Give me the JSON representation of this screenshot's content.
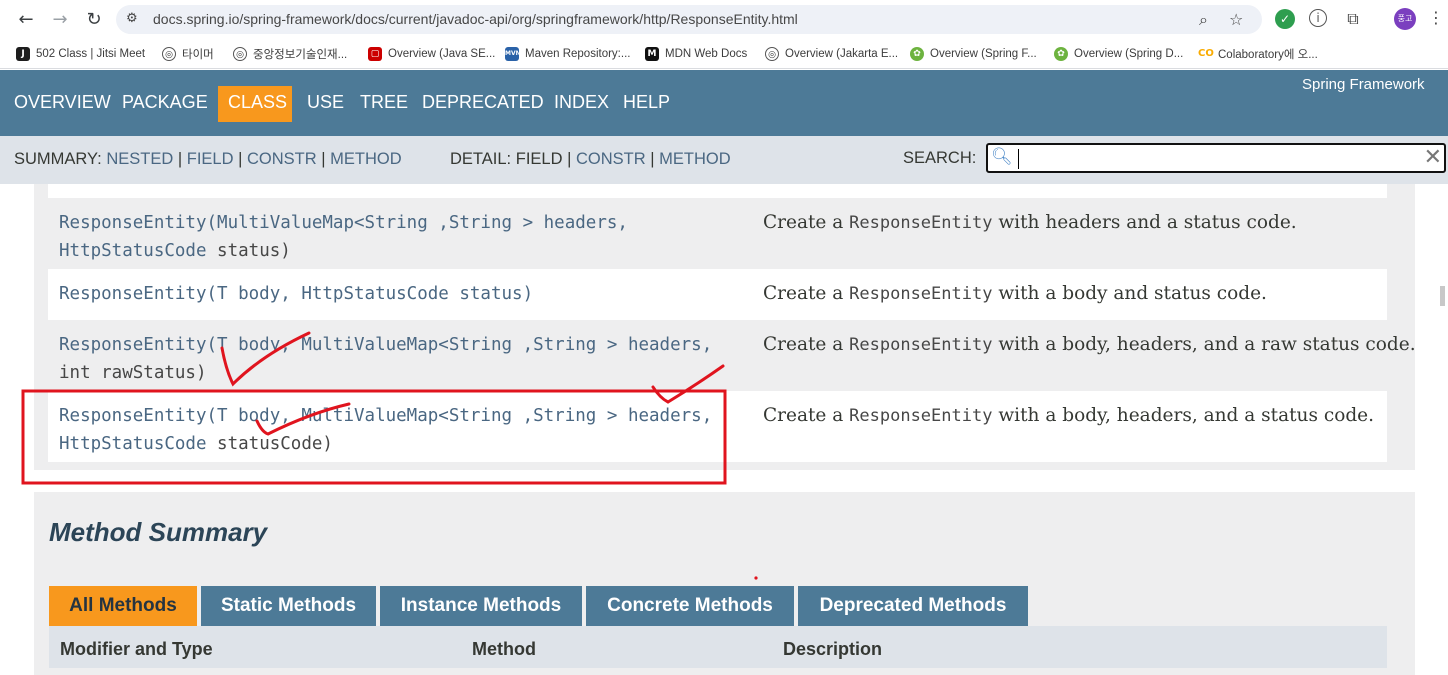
{
  "browser": {
    "url": "docs.spring.io/spring-framework/docs/current/javadoc-api/org/springframework/http/ResponseEntity.html",
    "avatar_label": "풍고",
    "bookmarks": [
      {
        "label": "502 Class | Jitsi Meet",
        "icon": "jitsi-icon"
      },
      {
        "label": "타이머",
        "icon": "globe-icon"
      },
      {
        "label": "중앙정보기술인재...",
        "icon": "globe-icon"
      },
      {
        "label": "Overview (Java SE...",
        "icon": "java-icon"
      },
      {
        "label": "Maven Repository:...",
        "icon": "maven-icon"
      },
      {
        "label": "MDN Web Docs",
        "icon": "mdn-icon"
      },
      {
        "label": "Overview (Jakarta E...",
        "icon": "globe-icon"
      },
      {
        "label": "Overview (Spring F...",
        "icon": "spring-icon"
      },
      {
        "label": "Overview (Spring D...",
        "icon": "spring-icon"
      },
      {
        "label": "Colaboratory에 오...",
        "icon": "colab-icon"
      }
    ]
  },
  "topnav": {
    "items": [
      "OVERVIEW",
      "PACKAGE",
      "CLASS",
      "USE",
      "TREE",
      "DEPRECATED",
      "INDEX",
      "HELP"
    ],
    "active": "CLASS",
    "brand": "Spring Framework"
  },
  "subnav": {
    "summary_label": "SUMMARY:",
    "summary_links": [
      "NESTED",
      "FIELD",
      "CONSTR",
      "METHOD"
    ],
    "detail_label": "DETAIL:",
    "detail_field": "FIELD",
    "detail_links": [
      "CONSTR",
      "METHOD"
    ],
    "separator": "|",
    "search_label": "SEARCH:"
  },
  "constructors": [
    {
      "line1_link": "ResponseEntity(MultiValueMap<String ,String > headers,",
      "line2_link": "HttpStatusCode",
      "line2_rest": " status)",
      "desc_pre": "Create a ",
      "desc_code": "ResponseEntity",
      "desc_post": " with headers and a status code."
    },
    {
      "line1_link": "ResponseEntity(T body, HttpStatusCode status)",
      "line2_link": "",
      "line2_rest": "",
      "desc_pre": "Create a ",
      "desc_code": "ResponseEntity",
      "desc_post": " with a body and status code."
    },
    {
      "line1_link": "ResponseEntity(T body, MultiValueMap<String ,String > headers,",
      "line2_link": "",
      "line2_rest": "int rawStatus)",
      "desc_pre": "Create a ",
      "desc_code": "ResponseEntity",
      "desc_post": " with a body, headers, and a raw status code."
    },
    {
      "line1_link": "ResponseEntity(T body, MultiValueMap<String ,String > headers,",
      "line2_link": "HttpStatusCode",
      "line2_rest": " statusCode)",
      "desc_pre": "Create a ",
      "desc_code": "ResponseEntity",
      "desc_post": " with a body, headers, and a status code."
    }
  ],
  "method_summary": {
    "title": "Method Summary",
    "tabs": [
      "All Methods",
      "Static Methods",
      "Instance Methods",
      "Concrete Methods",
      "Deprecated Methods"
    ],
    "active_tab": "All Methods",
    "columns": [
      "Modifier and Type",
      "Method",
      "Description"
    ]
  },
  "colors": {
    "nav_bg": "#4d7a97",
    "active_orange": "#f8981d",
    "link": "#4a6782",
    "annotation_red": "#e0141e"
  }
}
